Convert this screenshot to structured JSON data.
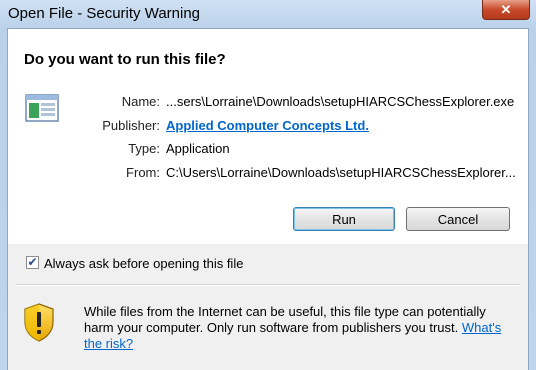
{
  "window": {
    "title": "Open File - Security Warning",
    "close_label": "✕"
  },
  "dialog": {
    "question": "Do you want to run this file?",
    "fields": {
      "name_label": "Name:",
      "name_value": "...sers\\Lorraine\\Downloads\\setupHIARCSChessExplorer.exe",
      "publisher_label": "Publisher:",
      "publisher_value": "Applied Computer Concepts Ltd.",
      "type_label": "Type:",
      "type_value": "Application",
      "from_label": "From:",
      "from_value": "C:\\Users\\Lorraine\\Downloads\\setupHIARCSChessExplorer..."
    },
    "buttons": {
      "run": "Run",
      "cancel": "Cancel"
    },
    "checkbox": {
      "label": "Always ask before opening this file",
      "checked": true,
      "mark": "✔"
    },
    "warning": {
      "text": "While files from the Internet can be useful, this file type can potentially harm your computer. Only run software from publishers you trust. ",
      "link": "What's the risk?"
    }
  }
}
